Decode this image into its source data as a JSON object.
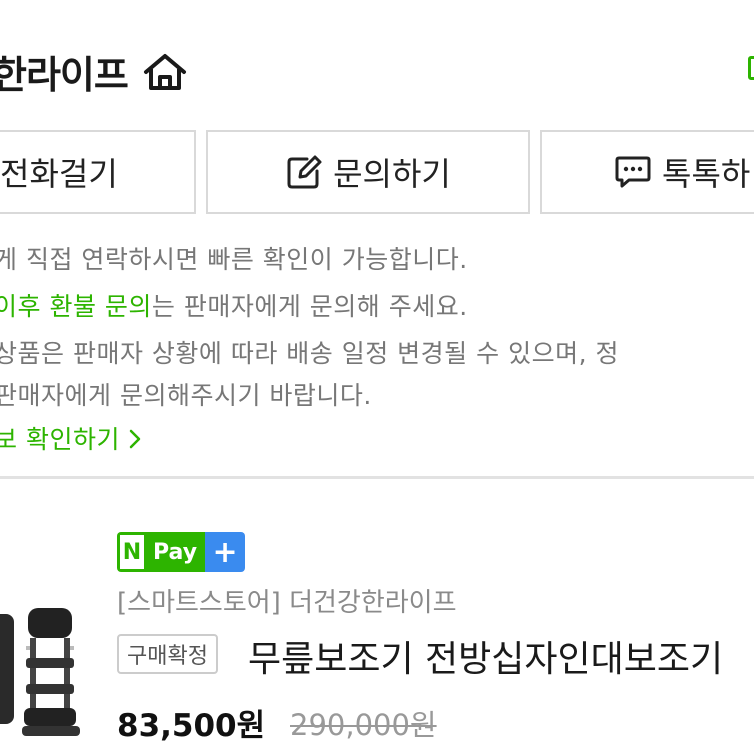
{
  "store": {
    "title": "한라이프"
  },
  "actions": {
    "call_label": "전화걸기",
    "inquiry_label": "문의하기",
    "talk_label": "톡톡하"
  },
  "notices": {
    "line1": "게 직접 연락하시면 빠른 확인이 가능합니다.",
    "line2_highlight": "이후 환불 문의",
    "line2_rest": "는 판매자에게 문의해 주세요.",
    "line3": "상품은 판매자 상황에 따라 배송 일정 변경될 수 있으며, 정",
    "line4": "판매자에게 문의해주시기 바랍니다.",
    "info_link": "보 확인하기"
  },
  "order": {
    "npay_n": "N",
    "npay_pay": "Pay",
    "npay_plus": "+",
    "store_line": "[스마트스토어] 더건강한라이프",
    "status_badge": "구매확정",
    "product_name": "무릎보조기 전방십자인대보조기",
    "price": "83,500원",
    "original_price": "290,000원"
  },
  "colors": {
    "accent_green": "#2db400",
    "npay_plus_blue": "#3a8bef",
    "notice_gray": "#777777"
  }
}
